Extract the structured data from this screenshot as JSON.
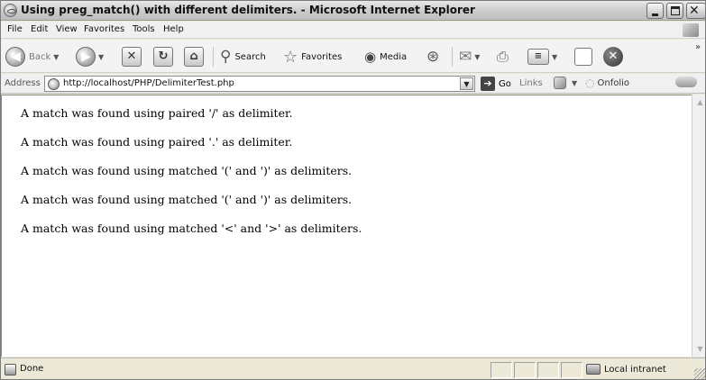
{
  "window": {
    "title": "Using preg_match() with different delimiters. - Microsoft Internet Explorer"
  },
  "menu": [
    "File",
    "Edit",
    "View",
    "Favorites",
    "Tools",
    "Help"
  ],
  "toolbar": {
    "back_label": "Back",
    "search_label": "Search",
    "favorites_label": "Favorites",
    "media_label": "Media"
  },
  "address": {
    "label": "Address",
    "url": "http://localhost/PHP/DelimiterTest.php",
    "go_label": "Go",
    "links_label": "Links",
    "onfolio_label": "Onfolio"
  },
  "content": {
    "lines": [
      "A match was found using paired '/' as delimiter.",
      "A match was found using paired '.' as delimiter.",
      "A match was found using matched '(' and ')' as delimiters.",
      "A match was found using matched '(' and ')' as delimiters.",
      "A match was found using matched '<' and '>' as delimiters."
    ]
  },
  "status": {
    "text": "Done",
    "zone": "Local intranet"
  }
}
